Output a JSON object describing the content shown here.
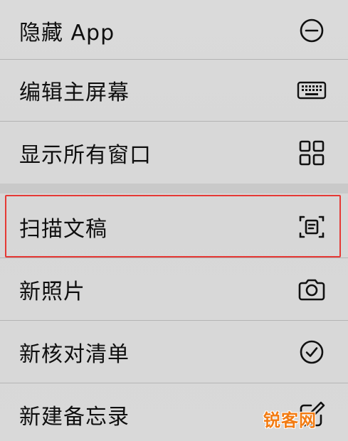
{
  "menu": {
    "items": [
      {
        "label": "隐藏 App",
        "icon": "minus-circle-icon"
      },
      {
        "label": "编辑主屏幕",
        "icon": "keyboard-icon"
      },
      {
        "label": "显示所有窗口",
        "icon": "grid-icon"
      },
      {
        "label": "扫描文稿",
        "icon": "document-scan-icon"
      },
      {
        "label": "新照片",
        "icon": "camera-icon"
      },
      {
        "label": "新核对清单",
        "icon": "checkmark-circle-icon"
      },
      {
        "label": "新建备忘录",
        "icon": "compose-icon"
      }
    ]
  },
  "watermark": {
    "text": "锐客网"
  },
  "colors": {
    "highlight_border": "#e53935",
    "watermark": "#f27b12",
    "background": "#d9d9d9"
  }
}
